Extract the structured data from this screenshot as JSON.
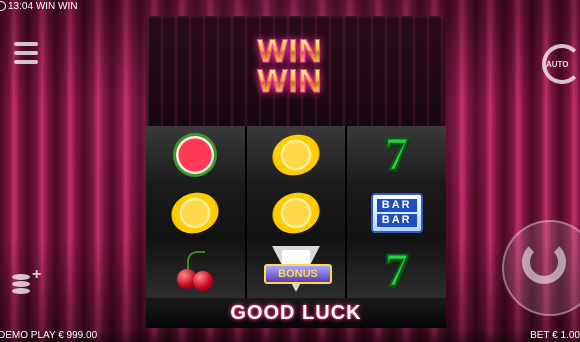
{
  "status": {
    "time": "13:04",
    "game_title": "WIN WIN"
  },
  "logo": {
    "line1": "WIN",
    "line2": "WIN"
  },
  "reels": [
    [
      {
        "symbol": "watermelon-icon"
      },
      {
        "symbol": "lemon-icon"
      },
      {
        "symbol": "cherry-icon"
      }
    ],
    [
      {
        "symbol": "lemon-icon"
      },
      {
        "symbol": "lemon-icon"
      },
      {
        "symbol": "bonus-icon",
        "text": "BONUS"
      }
    ],
    [
      {
        "symbol": "seven-icon",
        "text": "7"
      },
      {
        "symbol": "bar-icon",
        "text": "BAR"
      },
      {
        "symbol": "seven-icon",
        "text": "7"
      }
    ]
  ],
  "message": "GOOD LUCK",
  "footer": {
    "balance": "DEMO PLAY € 999.00",
    "bet": "BET € 1.00"
  },
  "controls": {
    "auto_label": "AUTO"
  },
  "colors": {
    "accent": "#ff2d7a",
    "gold": "#f5c83a",
    "curtain": "#c2306a"
  }
}
